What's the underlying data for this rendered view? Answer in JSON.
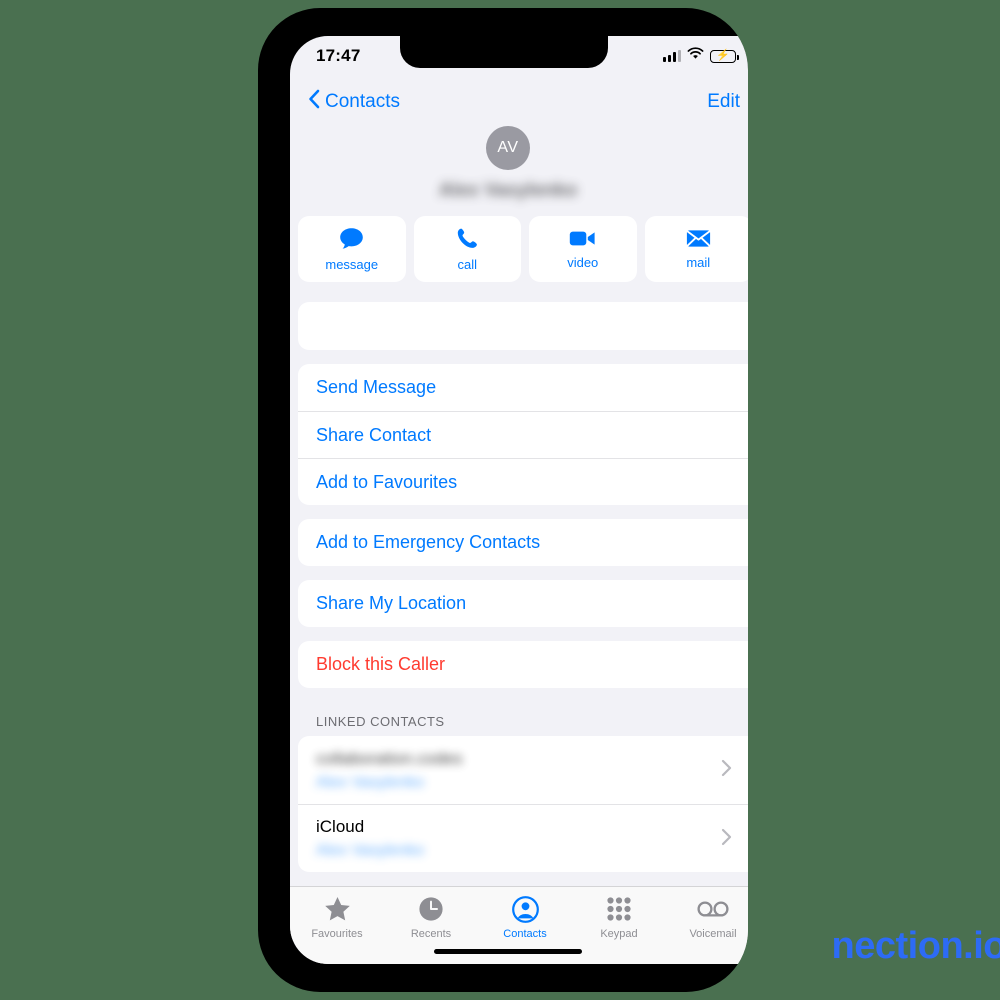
{
  "status_bar": {
    "time": "17:47",
    "cellular_icon": "cellular-bars-icon",
    "wifi_icon": "wifi-icon",
    "battery_icon": "battery-charging-icon",
    "battery_color": "#32d74b"
  },
  "nav": {
    "back_label": "Contacts",
    "back_icon": "chevron-left-icon",
    "edit_label": "Edit"
  },
  "contact": {
    "avatar_initials": "AV",
    "avatar_color": "#9a9aa2",
    "name": "Alex Vasylenko",
    "name_redacted": true
  },
  "actions": [
    {
      "label": "message",
      "icon": "message-bubble-icon"
    },
    {
      "label": "call",
      "icon": "phone-icon"
    },
    {
      "label": "video",
      "icon": "video-camera-icon"
    },
    {
      "label": "mail",
      "icon": "envelope-icon"
    }
  ],
  "blank_card": {
    "present": true,
    "redacted": true
  },
  "menu_groups": [
    {
      "rows": [
        {
          "label": "Send Message",
          "style": "link"
        },
        {
          "label": "Share Contact",
          "style": "link"
        },
        {
          "label": "Add to Favourites",
          "style": "link"
        }
      ]
    },
    {
      "rows": [
        {
          "label": "Add to Emergency Contacts",
          "style": "link"
        }
      ]
    },
    {
      "rows": [
        {
          "label": "Share My Location",
          "style": "link"
        }
      ]
    },
    {
      "rows": [
        {
          "label": "Block this Caller",
          "style": "danger"
        }
      ]
    }
  ],
  "linked_contacts": {
    "header": "LINKED CONTACTS",
    "rows": [
      {
        "title": "collaboration.codes",
        "title_redacted": true,
        "subtitle": "Alex Vasylenko",
        "chevron": "chevron-right-icon"
      },
      {
        "title": "iCloud",
        "title_redacted": false,
        "subtitle": "Alex Vasylenko",
        "chevron": "chevron-right-icon"
      }
    ]
  },
  "tab_bar": {
    "active_color": "#007aff",
    "inactive_color": "#8e8e93",
    "tabs": [
      {
        "label": "Favourites",
        "icon": "star-icon",
        "active": false
      },
      {
        "label": "Recents",
        "icon": "clock-icon",
        "active": false
      },
      {
        "label": "Contacts",
        "icon": "person-circle-icon",
        "active": true
      },
      {
        "label": "Keypad",
        "icon": "keypad-grid-icon",
        "active": false
      },
      {
        "label": "Voicemail",
        "icon": "voicemail-icon",
        "active": false
      }
    ]
  },
  "watermark": {
    "text": "nection.io",
    "color": "#2d6bf5"
  },
  "theme": {
    "background": "#4a7050",
    "screen_bg": "#f2f2f7",
    "card_bg": "#ffffff"
  }
}
